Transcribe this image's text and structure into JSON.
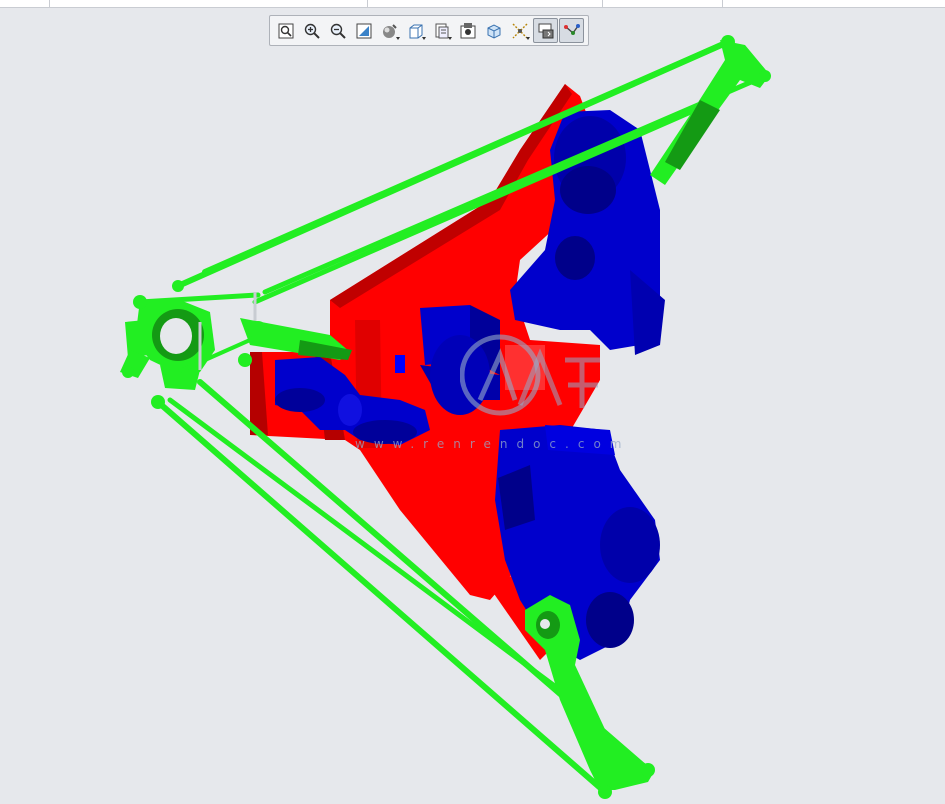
{
  "toolbar": {
    "buttons": [
      {
        "icon": "zoom-fit-icon"
      },
      {
        "icon": "zoom-in-icon"
      },
      {
        "icon": "zoom-out-icon"
      },
      {
        "icon": "repaint-icon"
      },
      {
        "icon": "display-style-icon"
      },
      {
        "icon": "saved-orientations-icon"
      },
      {
        "icon": "view-manager-icon"
      },
      {
        "icon": "perspective-icon"
      },
      {
        "icon": "spin-center-icon"
      },
      {
        "icon": "datum-display-icon"
      },
      {
        "icon": "annotation-display-icon"
      },
      {
        "icon": "mechanism-display-icon"
      }
    ]
  },
  "colors": {
    "background": "#e6e8ec",
    "frame": "#ff0000",
    "frame_dark": "#b50000",
    "motors": "#0000cc",
    "motors_dark": "#00007a",
    "arms": "#22ee22",
    "arms_dark": "#149a14"
  },
  "watermark": {
    "site": "www.renrendoc.com"
  }
}
